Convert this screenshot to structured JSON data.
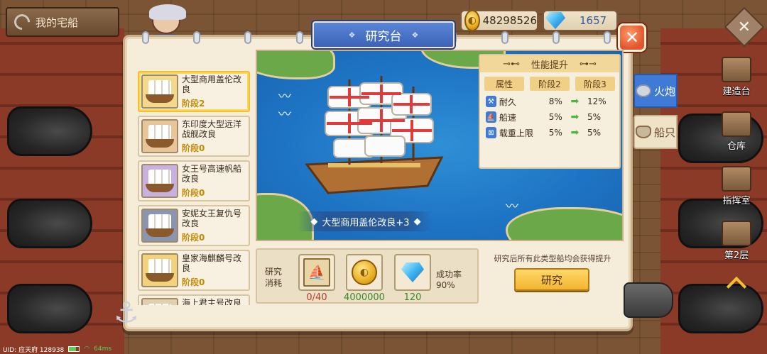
{
  "header": {
    "back_label": "我的宅船",
    "gold": "48298526",
    "gems": "1657",
    "panel_title": "研究台"
  },
  "ships": [
    {
      "name": "大型商用盖伦改良",
      "stage": "阶段2",
      "selected": true
    },
    {
      "name": "东印度大型远洋战舰改良",
      "stage": "阶段0",
      "selected": false
    },
    {
      "name": "女王号高速帆船改良",
      "stage": "阶段0",
      "selected": false
    },
    {
      "name": "安妮女王复仇号改良",
      "stage": "阶段0",
      "selected": false
    },
    {
      "name": "皇家海麒麟号改良",
      "stage": "阶段0",
      "selected": false
    },
    {
      "name": "海上君主号改良",
      "stage": "",
      "selected": false
    }
  ],
  "preview": {
    "ship_name": "大型商用盖伦改良+3"
  },
  "stats": {
    "title": "性能提升",
    "col_attr": "属性",
    "col_stage_from": "阶段2",
    "col_stage_to": "阶段3",
    "rows": [
      {
        "icon": "durability-icon",
        "label": "耐久",
        "from": "8%",
        "to": "12%"
      },
      {
        "icon": "speed-icon",
        "label": "船速",
        "from": "5%",
        "to": "5%"
      },
      {
        "icon": "cargo-icon",
        "label": "载重上限",
        "from": "5%",
        "to": "5%"
      }
    ]
  },
  "side_tabs": {
    "cannon": "火炮",
    "ship": "船只"
  },
  "right_nav": [
    {
      "label": "建造台"
    },
    {
      "label": "仓库"
    },
    {
      "label": "指挥室"
    },
    {
      "label": "第2层"
    }
  ],
  "research": {
    "cost_label": "研究消耗",
    "blueprint_count": "0/40",
    "gold_cost": "4000000",
    "gem_cost": "120",
    "success_label": "成功率",
    "success_rate": "90%",
    "note": "研究后所有此类型船均会获得提升",
    "button": "研究"
  },
  "status_bar": {
    "uid": "UID: 应天府 128938",
    "ping": "64ms"
  },
  "colors": {
    "accent_blue": "#3f7ad6",
    "gold_button": "#f2b530",
    "stage_text": "#c48a00",
    "arrow_green": "#4ab83a"
  }
}
